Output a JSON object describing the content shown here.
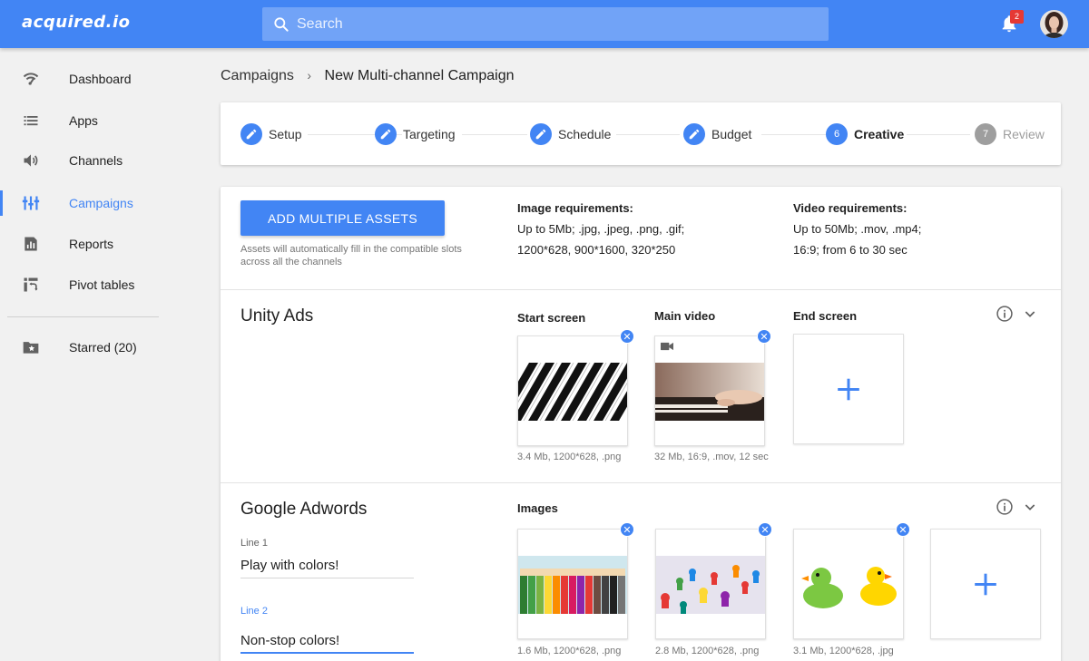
{
  "app": {
    "logo": "acquired.io"
  },
  "search": {
    "placeholder": "Search"
  },
  "notifications": {
    "count": "2"
  },
  "sidebar": {
    "items": [
      {
        "label": "Dashboard",
        "icon": "dashboard-icon"
      },
      {
        "label": "Apps",
        "icon": "list-icon"
      },
      {
        "label": "Channels",
        "icon": "speaker-icon"
      },
      {
        "label": "Campaigns",
        "icon": "campaigns-icon",
        "active": true
      },
      {
        "label": "Reports",
        "icon": "reports-icon"
      },
      {
        "label": "Pivot tables",
        "icon": "pivot-icon"
      },
      {
        "label": "Starred (20)",
        "icon": "starred-folder-icon"
      }
    ]
  },
  "breadcrumb": {
    "parent": "Campaigns",
    "separator": "›",
    "current": "New Multi-channel Campaign"
  },
  "stepper": {
    "steps": [
      {
        "label": "Setup",
        "state": "done"
      },
      {
        "label": "Targeting",
        "state": "done"
      },
      {
        "label": "Schedule",
        "state": "done"
      },
      {
        "label": "Budget",
        "state": "done"
      },
      {
        "label": "Creative",
        "number": "6",
        "state": "current"
      },
      {
        "label": "Review",
        "number": "7",
        "state": "disabled"
      }
    ]
  },
  "assets_header": {
    "button_label": "ADD MULTIPLE ASSETS",
    "hint": "Assets will automatically fill in the compatible slots across all the channels",
    "image_req": {
      "title": "Image requirements:",
      "line1": "Up to 5Mb; .jpg, .jpeg, .png, .gif;",
      "line2": "1200*628, 900*1600, 320*250"
    },
    "video_req": {
      "title": "Video requirements:",
      "line1": "Up to 50Mb; .mov, .mp4;",
      "line2": "16:9; from 6 to 30 sec"
    }
  },
  "unity": {
    "title": "Unity Ads",
    "slots": [
      {
        "label": "Start screen",
        "meta": "3.4 Mb, 1200*628, .png"
      },
      {
        "label": "Main video",
        "meta": "32 Mb, 16:9, .mov, 12 sec"
      },
      {
        "label": "End screen"
      }
    ]
  },
  "adwords": {
    "title": "Google Adwords",
    "images_label": "Images",
    "line1": {
      "label": "Line 1",
      "value": "Play with colors!"
    },
    "line2": {
      "label": "Line 2",
      "value": "Non-stop colors!"
    },
    "images": [
      {
        "meta": "1.6 Mb, 1200*628, .png"
      },
      {
        "meta": "2.8 Mb, 1200*628, .png"
      },
      {
        "meta": "3.1 Mb, 1200*628, .jpg"
      }
    ]
  },
  "colors": {
    "accent": "#4285f4",
    "badge": "#e53935",
    "background": "#f1f1f1"
  }
}
